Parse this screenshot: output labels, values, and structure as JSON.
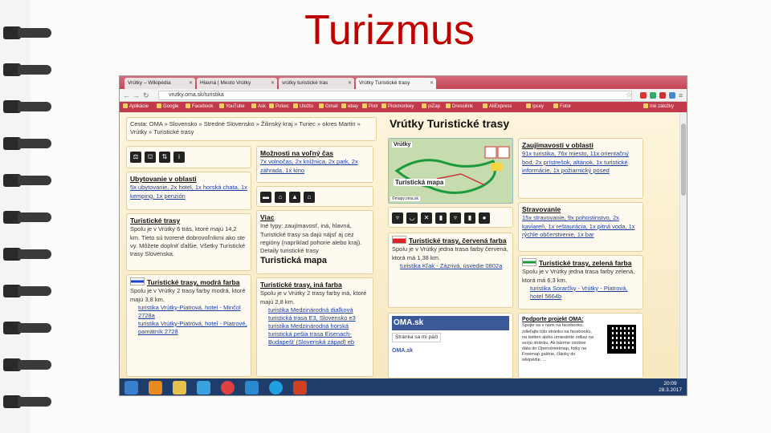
{
  "slide": {
    "title": "Turizmus"
  },
  "browser": {
    "tabs": [
      {
        "label": "Vrútky – Wikipédia"
      },
      {
        "label": "Hlavná | Mesto Vrútky"
      },
      {
        "label": "vrútky turistické tras"
      },
      {
        "label": "Vrútky Turistické trasy"
      }
    ],
    "url": "vrutky.oma.sk/turistika",
    "bookmarks": [
      "Aplikácie",
      "Google",
      "Facebook",
      "YouTube",
      "Ask",
      "Pokec",
      "Uložto",
      "Gmail",
      "ebay",
      "Pixlr",
      "Pickmonkey",
      "piZap",
      "Dressilink",
      "AliExpress",
      "ipcey",
      "Fotor",
      "Iné záložky"
    ]
  },
  "page": {
    "breadcrumb": "Cesta: OMA » Slovensko » Stredné Slovensko » Žilinský kraj » Turiec » okres Martin » Vrútky » Turistické trasy",
    "heading": "Vrútky Turistické trasy",
    "moznosti": {
      "title": "Možnosti na voľný čas",
      "text": "7x volnočas, 2x knižnica, 2x park, 2x záhrada, 1x kino"
    },
    "zaujimavosti": {
      "title": "Zaujímavosti v oblasti",
      "text": "91x turistika, 76x miesto, 11x orientačný bod, 2x prístrešok, altánok, 1x turistické informácie, 1x požiarnický posed"
    },
    "ubytovanie": {
      "title": "Ubytovanie v oblasti",
      "text": "5x ubytovanie, 2x hotel, 1x horská chata, 1x kemping, 1x penzión"
    },
    "stravovanie": {
      "title": "Stravovanie",
      "text": "15x stravovanie, 9x pohostinstvo, 2x kaviareň, 1x reštaurácia, 1x pitná voda, 1x rýchle občerstvenie, 1x bar"
    },
    "turisticke": {
      "title": "Turistické trasy",
      "text": "Spolu je v Vrútky 6 trás, ktoré majú 14,2 km. Tieto sú tvorené dobrovoľníkmi ako ste vy. Môžete doplniť ďalšie. Všetky Turistické trasy Slovenska."
    },
    "viac": {
      "title": "Viac",
      "text": "Iné typy: zaujímavosť, iná, hlavná, Turistické trasy sa dajú nájsť aj cez regióny (napríklad pohorie alebo kraj). Detaily turistické trasy",
      "map_link": "Turistická mapa"
    },
    "map": {
      "town": "Vrútky",
      "label": "Turistická mapa",
      "credit": "©mapy.oma.sk"
    },
    "cervena": {
      "title": "Turistické trasy, červená farba",
      "text": "Spolu je v Vrútky jedna trasa farby červená, ktorá má 1,38 km.",
      "items": [
        "turistika Kľak - Zázrivá, úsvedie 0802a"
      ]
    },
    "zelena": {
      "title": "Turistické trasy, zelená farba",
      "text": "Spolu je v Vrútky jedna trasa farby zelená, ktorá má 6,3 km.",
      "items": [
        "turistika Sorarčky - Vrútky - Piatrová, hotel 5664b"
      ]
    },
    "modra": {
      "title": "Turistické trasy, modrá farba",
      "text": "Spolu je v Vrútky 2 trasy farby modrá, ktoré majú 3,8 km.",
      "items": [
        "turistika Vrútky-Piatrová, hotel - Minčol 2728a",
        "turistika Vrútky-Piatrová, hotel - Piatrové, pamätník 2728"
      ]
    },
    "ina": {
      "title": "Turistické trasy, iná farba",
      "text": "Spolu je v Vrútky 2 trasy farby iná, ktoré majú 2,8 km.",
      "items": [
        "turistika Medzinárodná diaľková turistická trasa E3, Slovensko e3",
        "turistika Medzinárodná horská turistická pešia trasa Eisenach-Budapešť (Slovenská západ) eb"
      ]
    },
    "facebook": {
      "name": "OMA.sk",
      "like": "Stránka sa mi páči",
      "sub": "OMA.sk"
    },
    "podpora": {
      "title": "Podporte projekt OMA:",
      "text": "Spojte sa s nami na facebooku, zdieľajte túto stránku na facebooku, na twitteri alebo umiestnite odkaz na svoju stránku. Ak bánme osobne dáta do Openstreetmap, fotky na Freemap galérie, články do wikipédie, ..."
    }
  },
  "taskbar": {
    "time": "20:09",
    "date": "28.3.2017"
  }
}
